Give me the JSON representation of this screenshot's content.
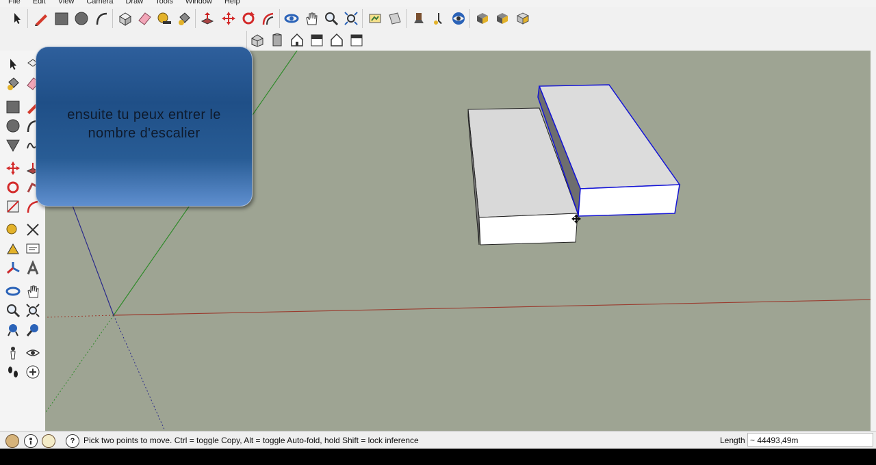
{
  "menubar": {
    "items": [
      "File",
      "Edit",
      "View",
      "Camera",
      "Draw",
      "Tools",
      "Window",
      "Help"
    ]
  },
  "tooltip": {
    "line1": "ensuite tu peux entrer le",
    "line2": "nombre d'escalier"
  },
  "statusbar": {
    "message": "Pick two points to move.  Ctrl = toggle Copy, Alt = toggle Auto-fold, hold Shift = lock inference",
    "length_label": "Length",
    "length_value": "~ 44493,49m"
  },
  "colors": {
    "viewport_bg": "#9ea493",
    "selection": "#1515d6",
    "axis_red": "#9a3b2e",
    "axis_green": "#2f8a2a",
    "axis_blue": "#2a2a8a"
  },
  "icons": {
    "top_toolbar": [
      "select-arrow-icon",
      "line-pencil-icon",
      "rectangle-icon",
      "circle-icon",
      "arc-icon",
      "make-component-icon",
      "eraser-icon",
      "tape-measure-icon",
      "paint-bucket-icon",
      "push-pull-icon",
      "move-icon",
      "rotate-icon",
      "offset-icon",
      "orbit-icon",
      "pan-icon",
      "zoom-icon",
      "zoom-extents-icon",
      "walkthrough-icon",
      "section-plane-icon",
      "position-camera-icon",
      "walk-icon",
      "look-around-icon",
      "get-models-icon",
      "share-model-icon",
      "share-component-icon"
    ],
    "views_toolbar": [
      "iso-view-icon",
      "top-view-icon",
      "front-view-icon",
      "right-view-icon",
      "back-view-icon",
      "left-view-icon"
    ]
  }
}
